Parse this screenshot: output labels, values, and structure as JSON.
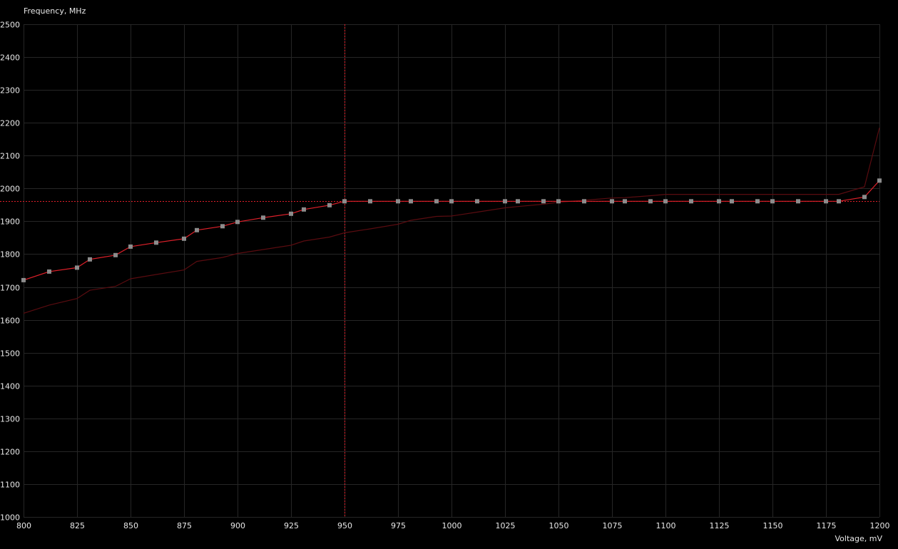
{
  "editor": {
    "y_axis_title": "Frequency, MHz",
    "x_axis_title": "Voltage, mV"
  },
  "colors": {
    "background": "#000000",
    "grid": "#262626",
    "active_curve": "#e0202a",
    "default_curve": "#5a0c10",
    "point": "#8c8c8c",
    "crosshair": "#e0202a",
    "label": "#e8e8e8"
  },
  "chart_data": {
    "type": "line",
    "xlabel": "Voltage, mV",
    "ylabel": "Frequency, MHz",
    "xlim": [
      800,
      1200
    ],
    "ylim": [
      1000,
      2500
    ],
    "x_ticks": [
      800,
      825,
      850,
      875,
      900,
      925,
      950,
      975,
      1000,
      1025,
      1050,
      1075,
      1100,
      1125,
      1150,
      1175,
      1200
    ],
    "y_ticks": [
      1000,
      1100,
      1200,
      1300,
      1400,
      1500,
      1600,
      1700,
      1800,
      1900,
      2000,
      2100,
      2200,
      2300,
      2400,
      2500
    ],
    "grid": true,
    "crosshair": {
      "voltage": 950,
      "frequency": 1961
    },
    "series": [
      {
        "role": "active",
        "markers": true,
        "points": [
          [
            800,
            1721
          ],
          [
            812,
            1747
          ],
          [
            825,
            1759
          ],
          [
            831,
            1784
          ],
          [
            843,
            1797
          ],
          [
            850,
            1823
          ],
          [
            862,
            1835
          ],
          [
            875,
            1847
          ],
          [
            881,
            1873
          ],
          [
            893,
            1885
          ],
          [
            900,
            1898
          ],
          [
            912,
            1911
          ],
          [
            925,
            1923
          ],
          [
            931,
            1936
          ],
          [
            943,
            1949
          ],
          [
            950,
            1961
          ],
          [
            962,
            1961
          ],
          [
            975,
            1961
          ],
          [
            981,
            1961
          ],
          [
            993,
            1961
          ],
          [
            1000,
            1961
          ],
          [
            1012,
            1961
          ],
          [
            1025,
            1961
          ],
          [
            1031,
            1961
          ],
          [
            1043,
            1961
          ],
          [
            1050,
            1961
          ],
          [
            1062,
            1961
          ],
          [
            1075,
            1961
          ],
          [
            1081,
            1961
          ],
          [
            1093,
            1961
          ],
          [
            1100,
            1961
          ],
          [
            1112,
            1961
          ],
          [
            1125,
            1961
          ],
          [
            1131,
            1961
          ],
          [
            1143,
            1961
          ],
          [
            1150,
            1961
          ],
          [
            1162,
            1961
          ],
          [
            1175,
            1961
          ],
          [
            1181,
            1961
          ],
          [
            1193,
            1974
          ],
          [
            1200,
            2024
          ]
        ]
      },
      {
        "role": "default",
        "markers": false,
        "points": [
          [
            800,
            1620
          ],
          [
            812,
            1645
          ],
          [
            825,
            1665
          ],
          [
            831,
            1690
          ],
          [
            843,
            1702
          ],
          [
            850,
            1725
          ],
          [
            862,
            1738
          ],
          [
            875,
            1752
          ],
          [
            881,
            1778
          ],
          [
            893,
            1790
          ],
          [
            900,
            1802
          ],
          [
            912,
            1814
          ],
          [
            925,
            1827
          ],
          [
            931,
            1840
          ],
          [
            943,
            1852
          ],
          [
            950,
            1865
          ],
          [
            962,
            1877
          ],
          [
            975,
            1891
          ],
          [
            981,
            1903
          ],
          [
            993,
            1915
          ],
          [
            1000,
            1916
          ],
          [
            1012,
            1928
          ],
          [
            1025,
            1941
          ],
          [
            1031,
            1945
          ],
          [
            1043,
            1952
          ],
          [
            1050,
            1958
          ],
          [
            1062,
            1964
          ],
          [
            1075,
            1971
          ],
          [
            1081,
            1972
          ],
          [
            1093,
            1978
          ],
          [
            1100,
            1982
          ],
          [
            1112,
            1982
          ],
          [
            1125,
            1982
          ],
          [
            1131,
            1982
          ],
          [
            1143,
            1982
          ],
          [
            1150,
            1982
          ],
          [
            1162,
            1982
          ],
          [
            1175,
            1982
          ],
          [
            1181,
            1982
          ],
          [
            1193,
            2005
          ],
          [
            1200,
            2185
          ]
        ]
      }
    ]
  }
}
